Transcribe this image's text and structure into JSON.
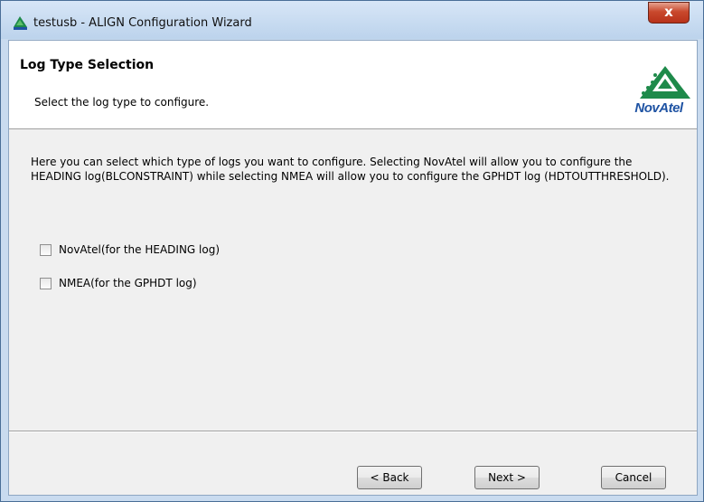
{
  "window": {
    "title": "testusb - ALIGN Configuration Wizard",
    "close_label": "x"
  },
  "header": {
    "title": "Log Type Selection",
    "subtitle": "Select the log type to configure.",
    "logo_text": "NovAtel"
  },
  "content": {
    "description": "Here you can select which type of logs you want to configure. Selecting NovAtel will allow you to configure the HEADING log(BLCONSTRAINT) while selecting NMEA will allow you to configure the GPHDT log (HDTOUTTHRESHOLD).",
    "options": [
      {
        "label": "NovAtel(for the HEADING log)",
        "checked": false
      },
      {
        "label": "NMEA(for the GPHDT log)",
        "checked": false
      }
    ]
  },
  "buttons": {
    "back": "< Back",
    "next": "Next >",
    "cancel": "Cancel"
  },
  "colors": {
    "logo_green": "#1e8a4a",
    "logo_blue": "#1f53a3",
    "close_red": "#c9492d"
  }
}
